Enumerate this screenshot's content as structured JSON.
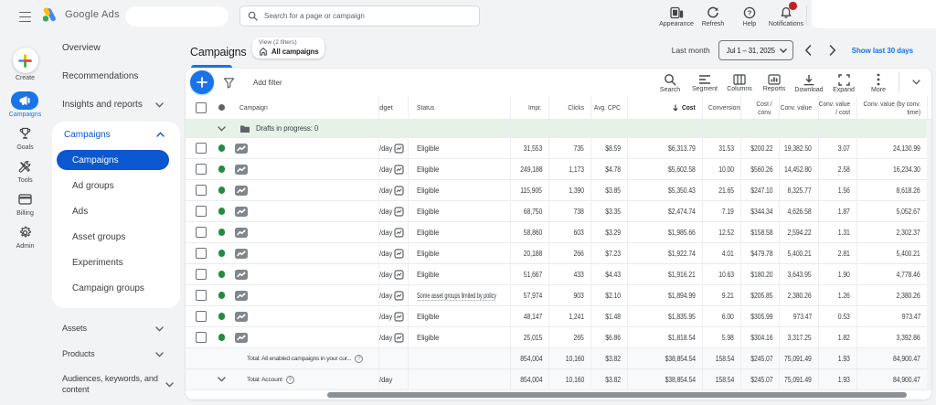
{
  "topbar": {
    "brand": "Google Ads",
    "search_placeholder": "Search for a page or campaign",
    "actions": [
      {
        "label": "Appearance",
        "icon": "appearance-icon"
      },
      {
        "label": "Refresh",
        "icon": "refresh-icon"
      },
      {
        "label": "Help",
        "icon": "help-icon"
      },
      {
        "label": "Notifications",
        "icon": "notifications-icon",
        "badge": true
      }
    ]
  },
  "rail": {
    "items": [
      {
        "label": "Create",
        "icon": "create-plus-icon",
        "kind": "create"
      },
      {
        "label": "Campaigns",
        "icon": "campaigns-megaphone-icon",
        "selected": true
      },
      {
        "label": "Goals",
        "icon": "goals-trophy-icon"
      },
      {
        "label": "Tools",
        "icon": "tools-wrench-icon"
      },
      {
        "label": "Billing",
        "icon": "billing-card-icon"
      },
      {
        "label": "Admin",
        "icon": "admin-gear-icon"
      }
    ]
  },
  "subnav": {
    "items_top": [
      {
        "label": "Overview"
      },
      {
        "label": "Recommendations"
      },
      {
        "label": "Insights and reports",
        "chevron": "down"
      }
    ],
    "campaigns_section": {
      "label": "Campaigns",
      "chevron": "up",
      "items": [
        {
          "label": "Campaigns",
          "selected": true
        },
        {
          "label": "Ad groups"
        },
        {
          "label": "Ads"
        },
        {
          "label": "Asset groups"
        },
        {
          "label": "Experiments"
        },
        {
          "label": "Campaign groups"
        }
      ]
    },
    "items_bottom": [
      {
        "label": "Assets",
        "chevron": "down"
      },
      {
        "label": "Products",
        "chevron": "down"
      },
      {
        "label": "Audiences, keywords, and content",
        "chevron": "down"
      }
    ]
  },
  "main": {
    "title": "Campaigns",
    "view_chip": {
      "line1": "View (2 filters)",
      "line2": "All campaigns"
    },
    "date": {
      "preset": "Last month",
      "range": "Jul 1 – 31, 2025",
      "link": "Show last 30 days"
    }
  },
  "toolbar": {
    "add_filter": "Add filter",
    "buttons": [
      {
        "label": "Search",
        "icon": "search-icon"
      },
      {
        "label": "Segment",
        "icon": "segment-icon"
      },
      {
        "label": "Columns",
        "icon": "columns-icon"
      },
      {
        "label": "Reports",
        "icon": "reports-icon"
      },
      {
        "label": "Download",
        "icon": "download-icon"
      },
      {
        "label": "Expand",
        "icon": "expand-icon"
      },
      {
        "label": "More",
        "icon": "more-icon"
      }
    ]
  },
  "table": {
    "columns": [
      "Campaign",
      "Budget",
      "Status",
      "Impr.",
      "Clicks",
      "Avg. CPC",
      "Cost",
      "Conversions",
      "Cost /\nconv.",
      "Conv. value",
      "Conv. value\n/ cost",
      "Conv. value (by conv.\ntime)"
    ],
    "sorted_column": "Cost",
    "sort_direction": "down",
    "drafts_row": {
      "label": "Drafts in progress: 0"
    },
    "budget_visible_suffix": "/day",
    "rows": [
      {
        "status": "Eligible",
        "impr": "31,553",
        "clicks": "735",
        "avg_cpc": "$8.59",
        "cost": "$6,313.79",
        "conversions": "31.53",
        "cost_conv": "$200.22",
        "conv_value": "19,382.50",
        "conv_value_cost": "3.07",
        "conv_value_time": "24,130.99"
      },
      {
        "status": "Eligible",
        "impr": "249,188",
        "clicks": "1,173",
        "avg_cpc": "$4.78",
        "cost": "$5,602.58",
        "conversions": "10.00",
        "cost_conv": "$560.26",
        "conv_value": "14,452.80",
        "conv_value_cost": "2.58",
        "conv_value_time": "16,234.30"
      },
      {
        "status": "Eligible",
        "impr": "115,905",
        "clicks": "1,390",
        "avg_cpc": "$3.85",
        "cost": "$5,350.43",
        "conversions": "21.65",
        "cost_conv": "$247.10",
        "conv_value": "8,325.77",
        "conv_value_cost": "1.56",
        "conv_value_time": "8,618.26"
      },
      {
        "status": "Eligible",
        "impr": "68,750",
        "clicks": "738",
        "avg_cpc": "$3.35",
        "cost": "$2,474.74",
        "conversions": "7.19",
        "cost_conv": "$344.34",
        "conv_value": "4,626.58",
        "conv_value_cost": "1.87",
        "conv_value_time": "5,052.67"
      },
      {
        "status": "Eligible",
        "impr": "58,860",
        "clicks": "603",
        "avg_cpc": "$3.29",
        "cost": "$1,985.66",
        "conversions": "12.52",
        "cost_conv": "$158.58",
        "conv_value": "2,594.22",
        "conv_value_cost": "1.31",
        "conv_value_time": "2,302.37"
      },
      {
        "status": "Eligible",
        "impr": "20,188",
        "clicks": "266",
        "avg_cpc": "$7.23",
        "cost": "$1,922.74",
        "conversions": "4.01",
        "cost_conv": "$479.78",
        "conv_value": "5,400.21",
        "conv_value_cost": "2.81",
        "conv_value_time": "5,400.21"
      },
      {
        "status": "Eligible",
        "impr": "51,667",
        "clicks": "433",
        "avg_cpc": "$4.43",
        "cost": "$1,916.21",
        "conversions": "10.63",
        "cost_conv": "$180.20",
        "conv_value": "3,643.95",
        "conv_value_cost": "1.90",
        "conv_value_time": "4,778.46"
      },
      {
        "status": "Some asset groups limited by policy",
        "status_dotted": true,
        "impr": "57,974",
        "clicks": "903",
        "avg_cpc": "$2.10",
        "cost": "$1,894.99",
        "conversions": "9.21",
        "cost_conv": "$205.85",
        "conv_value": "2,380.26",
        "conv_value_cost": "1.26",
        "conv_value_time": "2,380.26"
      },
      {
        "status": "Eligible",
        "impr": "48,147",
        "clicks": "1,241",
        "avg_cpc": "$1.48",
        "cost": "$1,835.95",
        "conversions": "6.00",
        "cost_conv": "$305.99",
        "conv_value": "973.47",
        "conv_value_cost": "0.53",
        "conv_value_time": "973.47"
      },
      {
        "status": "Eligible",
        "impr": "25,015",
        "clicks": "265",
        "avg_cpc": "$6.86",
        "cost": "$1,818.54",
        "conversions": "5.98",
        "cost_conv": "$304.16",
        "conv_value": "3,317.25",
        "conv_value_cost": "1.82",
        "conv_value_time": "3,392.86"
      }
    ],
    "totals": [
      {
        "label": "Total: All enabled campaigns in your cur...",
        "has_chevron": false,
        "budget": "",
        "impr": "854,004",
        "clicks": "10,160",
        "avg_cpc": "$3.82",
        "cost": "$38,854.54",
        "conversions": "158.54",
        "cost_conv": "$245.07",
        "conv_value": "75,091.49",
        "conv_value_cost": "1.93",
        "conv_value_time": "84,900.47"
      },
      {
        "label": "Total: Account",
        "has_chevron": true,
        "budget": "/day",
        "impr": "854,004",
        "clicks": "10,160",
        "avg_cpc": "$3.82",
        "cost": "$38,854.54",
        "conversions": "158.54",
        "cost_conv": "$245.07",
        "conv_value": "75,091.49",
        "conv_value_cost": "1.93",
        "conv_value_time": "84,900.47"
      }
    ]
  }
}
